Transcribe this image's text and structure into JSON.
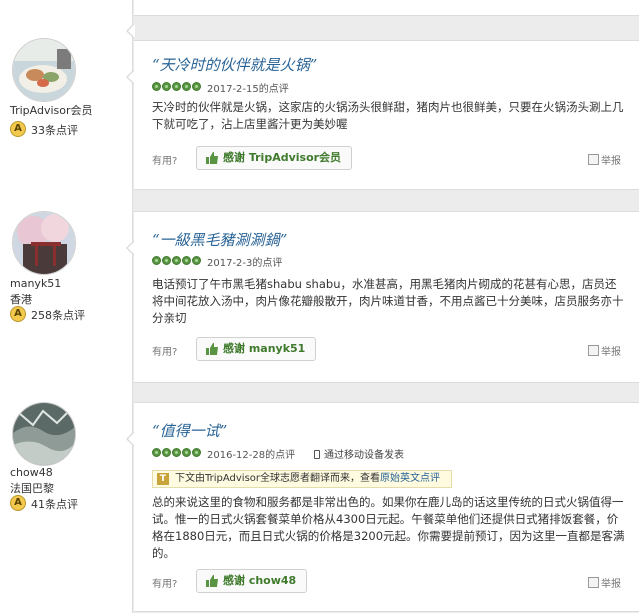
{
  "reviews": [
    {
      "user": {
        "name": "TripAdvisor会员",
        "location": "",
        "review_count": "33条点评"
      },
      "title": "“天冷时的伙伴就是火锅”",
      "rating": 5,
      "date": "2017-2-15的点评",
      "mobile": "",
      "translated_note": "",
      "body": "天冷时的伙伴就是火锅，这家店的火锅汤头很鲜甜，猪肉片也很鲜美，只要在火锅汤头涮上几下就可吃了，沾上店里酱汁更为美妙喔",
      "helpful_label": "有用?",
      "thanks_label": "感谢 TripAdvisor会员",
      "report_label": "举报"
    },
    {
      "user": {
        "name": "manyk51",
        "location": "香港",
        "review_count": "258条点评"
      },
      "title": "“一級黑毛豬涮涮鍋”",
      "rating": 5,
      "date": "2017-2-3的点评",
      "mobile": "",
      "translated_note": "",
      "body": "电话预订了午市黑毛猪shabu shabu，水准甚高，用黑毛猪肉片砌成的花甚有心思，店员还将中间花放入汤中，肉片像花瓣般散开，肉片味道甘香，不用点酱已十分美味，店员服务亦十分亲切",
      "helpful_label": "有用?",
      "thanks_label": "感谢 manyk51",
      "report_label": "举报"
    },
    {
      "user": {
        "name": "chow48",
        "location": "法国巴黎",
        "review_count": "41条点评"
      },
      "title": "“值得一试”",
      "rating": 5,
      "date": "2016-12-28的点评",
      "mobile": "通过移动设备发表",
      "translated_note": {
        "prefix": "下文由TripAdvisor全球志愿者翻译而来，查看",
        "link": "原始英文点评"
      },
      "body": "总的来说这里的食物和服务都是非常出色的。如果你在鹿儿岛的话这里传统的日式火锅值得一试。惟一的日式火锅套餐菜单价格从4300日元起。午餐菜单他们还提供日式猪排饭套餐，价格在1880日元，而且日式火锅的价格是3200元起。你需要提前预订，因为这里一直都是客满的。",
      "helpful_label": "有用?",
      "thanks_label": "感谢 chow48",
      "report_label": "举报"
    }
  ],
  "colors": {
    "accent_green": "#589442",
    "link_blue": "#2a6496"
  },
  "icons": [
    "avatar-photo",
    "level-badge-icon",
    "rating-bubble-icon",
    "thumbs-up-icon",
    "flag-icon",
    "mobile-icon",
    "translate-icon"
  ]
}
